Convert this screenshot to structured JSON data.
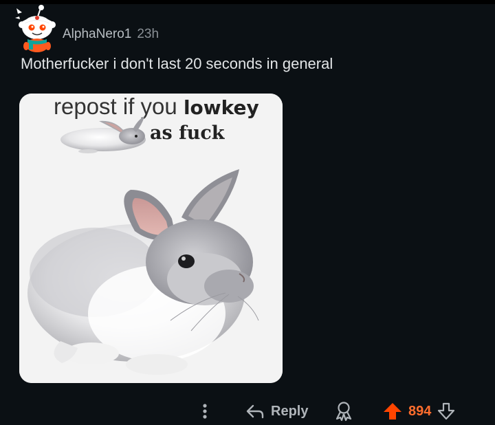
{
  "comment": {
    "username": "AlphaNero1",
    "age": "23h",
    "text": "Motherfucker i don't last 20 seconds in general",
    "image": {
      "line1_plain": "repost if you ",
      "line1_bold": "lowkey",
      "line2": "as fuck"
    }
  },
  "actions": {
    "reply_label": "Reply",
    "score": "894"
  },
  "icons": {
    "more": "more-vertical-icon",
    "reply": "reply-arrow-icon",
    "award": "award-icon",
    "upvote": "upvote-icon",
    "downvote": "downvote-icon"
  },
  "colors": {
    "background": "#0b1014",
    "upvote_active": "#ff4500",
    "score": "#ff6d2d"
  }
}
